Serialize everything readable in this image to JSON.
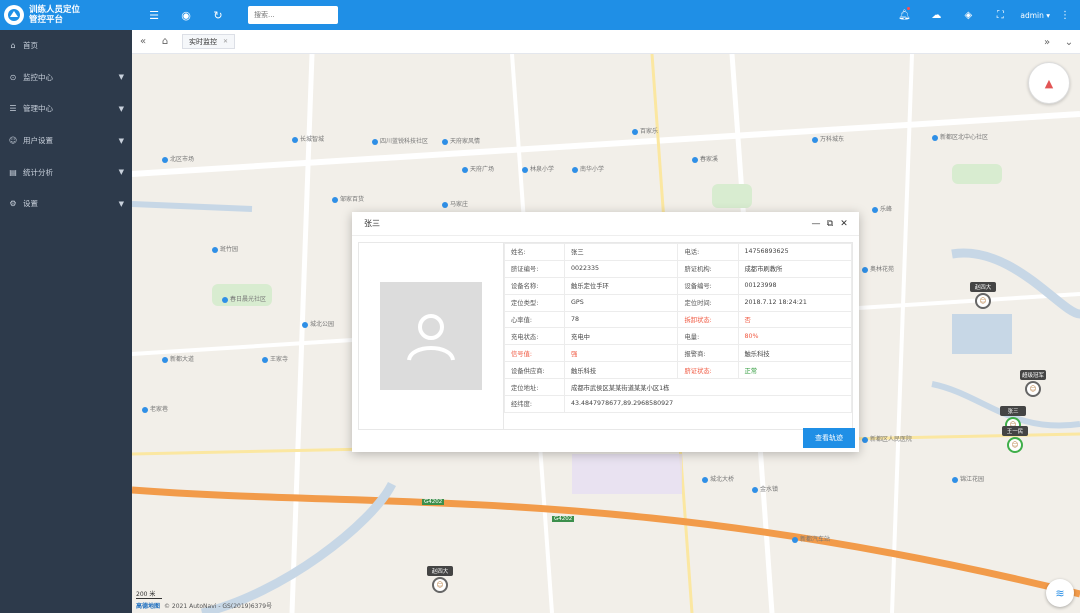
{
  "app": {
    "title_line1": "训练人员定位",
    "title_line2": "管控平台"
  },
  "sidebar": {
    "items": [
      {
        "label": "首页",
        "icon": "home-icon",
        "has_children": false
      },
      {
        "label": "监控中心",
        "icon": "monitor-icon",
        "has_children": true
      },
      {
        "label": "管理中心",
        "icon": "manage-icon",
        "has_children": true
      },
      {
        "label": "用户设置",
        "icon": "user-icon",
        "has_children": true
      },
      {
        "label": "统计分析",
        "icon": "chart-icon",
        "has_children": true
      },
      {
        "label": "设置",
        "icon": "gear-icon",
        "has_children": true
      }
    ]
  },
  "header": {
    "search_placeholder": "搜索...",
    "user": "admin"
  },
  "tabs": [
    {
      "label": "实时监控"
    }
  ],
  "map": {
    "labels": [
      "长城智城",
      "天府家风情",
      "四川蓝锐科技社区",
      "万科城东",
      "百家乐",
      "新都区北中心社区",
      "北区市场",
      "春日晨光社区",
      "新都区人民医院",
      "新都大道",
      "天府广场",
      "邹家百货",
      "城北公园",
      "南华小学",
      "林泉小学",
      "王家寺",
      "春家溪",
      "奥林花苑",
      "斑竹园",
      "马家庄",
      "老家巷",
      "城北大桥",
      "乐峰",
      "金水镇",
      "锦江花园",
      "新都汽车站"
    ],
    "roads": [
      "G4202",
      "G4202"
    ],
    "markers": [
      {
        "name": "赵四大"
      },
      {
        "name": "超级冠军"
      },
      {
        "name": "张三"
      },
      {
        "name": "王一民"
      },
      {
        "name": "赵四大"
      }
    ],
    "scale": "200 米",
    "brand": "高德地图",
    "copyright": "© 2021 AutoNavi - GS(2019)6379号"
  },
  "dialog": {
    "title": "张三",
    "button": "查看轨迹",
    "rows": [
      {
        "k1": "姓名:",
        "v1": "张三",
        "k2": "电话:",
        "v2": "14756893625"
      },
      {
        "k1": "脐证编号:",
        "v1": "0022335",
        "k2": "脐证机构:",
        "v2": "成都市刷教所"
      },
      {
        "k1": "设备名称:",
        "v1": "触乐定位手环",
        "k2": "设备编号:",
        "v2": "00123998"
      },
      {
        "k1": "定位类型:",
        "v1": "GPS",
        "k2": "定位时间:",
        "v2": "2018.7.12 18:24:21"
      },
      {
        "k1": "心率值:",
        "v1": "78",
        "k2": "拆卸状态:",
        "v2": "否",
        "k2_red": true,
        "v2_red": true
      },
      {
        "k1": "充电状态:",
        "v1": "充电中",
        "k2": "电量:",
        "v2": "80%",
        "v2_red": true
      },
      {
        "k1": "信号值:",
        "v1": "强",
        "k2": "报警商:",
        "v2": "触乐科技",
        "k1_red": true,
        "v1_red": true
      },
      {
        "k1": "设备供应商:",
        "v1": "触乐科技",
        "k2": "脐证状态:",
        "v2": "正常",
        "k2_red": true,
        "v2_green": true
      }
    ],
    "address_label": "定位地址:",
    "address": "成都市武侯区某某街道某某小区1栋",
    "coords_label": "经纬度:",
    "coords": "43.4847978677,89.2968580927"
  }
}
